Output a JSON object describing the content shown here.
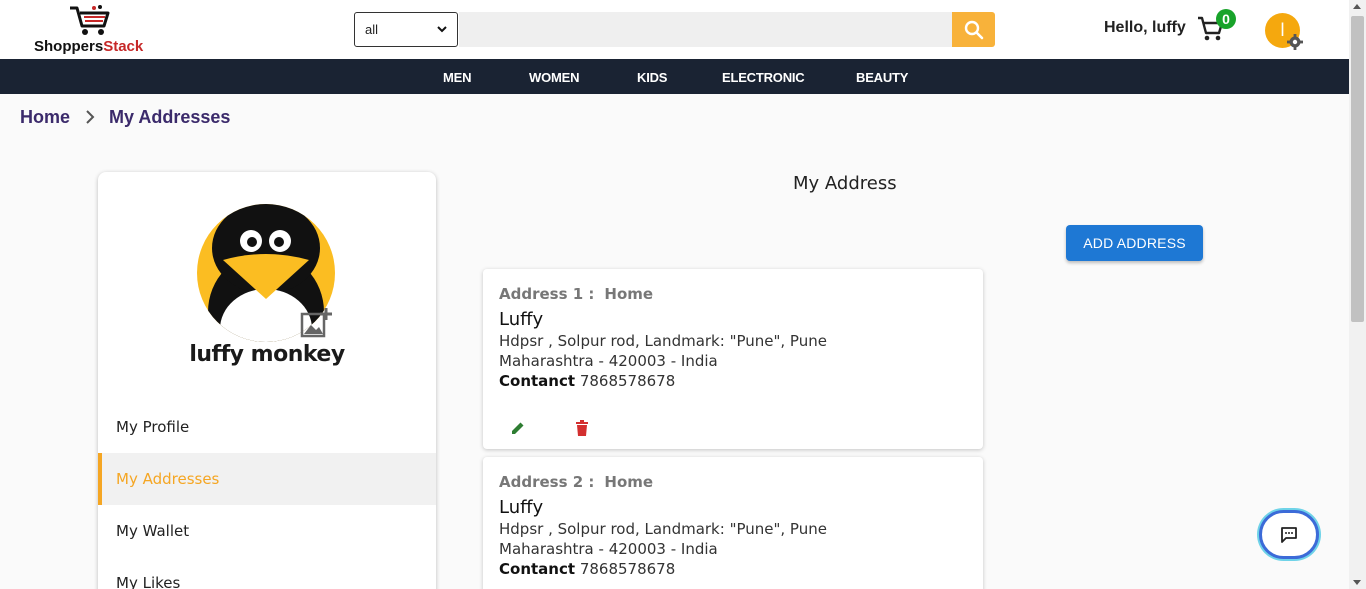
{
  "header": {
    "logo": {
      "text_main": "Shoppers",
      "text_accent": "Stack"
    },
    "search": {
      "category_value": "all",
      "placeholder": ""
    },
    "greeting": "Hello, luffy",
    "cart_count": "0",
    "avatar_initial": "l"
  },
  "nav": {
    "items": [
      {
        "label": "MEN"
      },
      {
        "label": "WOMEN"
      },
      {
        "label": "KIDS"
      },
      {
        "label": "ELECTRONIC"
      },
      {
        "label": "BEAUTY"
      }
    ]
  },
  "breadcrumb": {
    "home": "Home",
    "current": "My Addresses"
  },
  "profile": {
    "name": "luffy monkey",
    "menu": [
      {
        "label": "My Profile",
        "active": false
      },
      {
        "label": "My Addresses",
        "active": true
      },
      {
        "label": "My Wallet",
        "active": false
      },
      {
        "label": "My Likes",
        "active": false
      }
    ]
  },
  "main": {
    "title": "My Address",
    "add_button": "ADD ADDRESS",
    "addresses": [
      {
        "label": "Address 1 :",
        "type": "Home",
        "name": "Luffy",
        "line1": "Hdpsr , Solpur rod, Landmark: \"Pune\", Pune",
        "line2": "Maharashtra - 420003 - India",
        "contact_label": "Contanct",
        "contact": "7868578678"
      },
      {
        "label": "Address 2 :",
        "type": "Home",
        "name": "Luffy",
        "line1": "Hdpsr , Solpur rod, Landmark: \"Pune\", Pune",
        "line2": "Maharashtra - 420003 - India",
        "contact_label": "Contanct",
        "contact": "7868578678"
      }
    ]
  },
  "colors": {
    "navbar": "#1a2333",
    "accent_orange": "#f5a623",
    "search_button": "#f8b23a",
    "primary_button": "#1e78d4",
    "cart_badge": "#18a32a",
    "edit_icon": "#2e7d32",
    "delete_icon": "#d32f2f"
  },
  "icons": [
    "shopping-cart-icon",
    "search-icon",
    "chevron-down-icon",
    "settings-gear-icon",
    "chevron-right-icon",
    "add-photo-icon",
    "edit-pencil-icon",
    "delete-trash-icon",
    "chat-icon"
  ]
}
